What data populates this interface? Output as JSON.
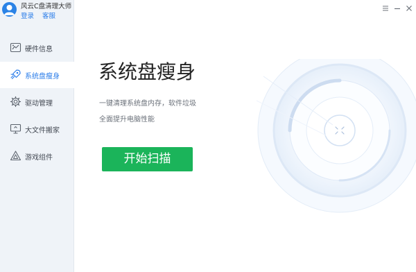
{
  "app": {
    "title": "风云C盘清理大师",
    "login_label": "登录",
    "service_label": "客服"
  },
  "sidebar": {
    "items": [
      {
        "label": "硬件信息",
        "icon": "hardware-info-icon",
        "active": false
      },
      {
        "label": "系统盘瘦身",
        "icon": "rocket-icon",
        "active": true
      },
      {
        "label": "驱动管理",
        "icon": "gear-icon",
        "active": false
      },
      {
        "label": "大文件搬家",
        "icon": "monitor-icon",
        "active": false
      },
      {
        "label": "游戏组件",
        "icon": "triangle-icon",
        "active": false
      }
    ]
  },
  "window": {
    "controls": [
      "menu-icon",
      "minimize-icon",
      "close-icon"
    ]
  },
  "main": {
    "title": "系统盘瘦身",
    "description_line1": "一键清理系统盘内存，软件垃圾",
    "description_line2": "全面提升电脑性能",
    "start_button": "开始扫描"
  },
  "colors": {
    "accent": "#2b7de9",
    "button": "#1bb45a",
    "sidebar_bg": "#eff3f8"
  }
}
